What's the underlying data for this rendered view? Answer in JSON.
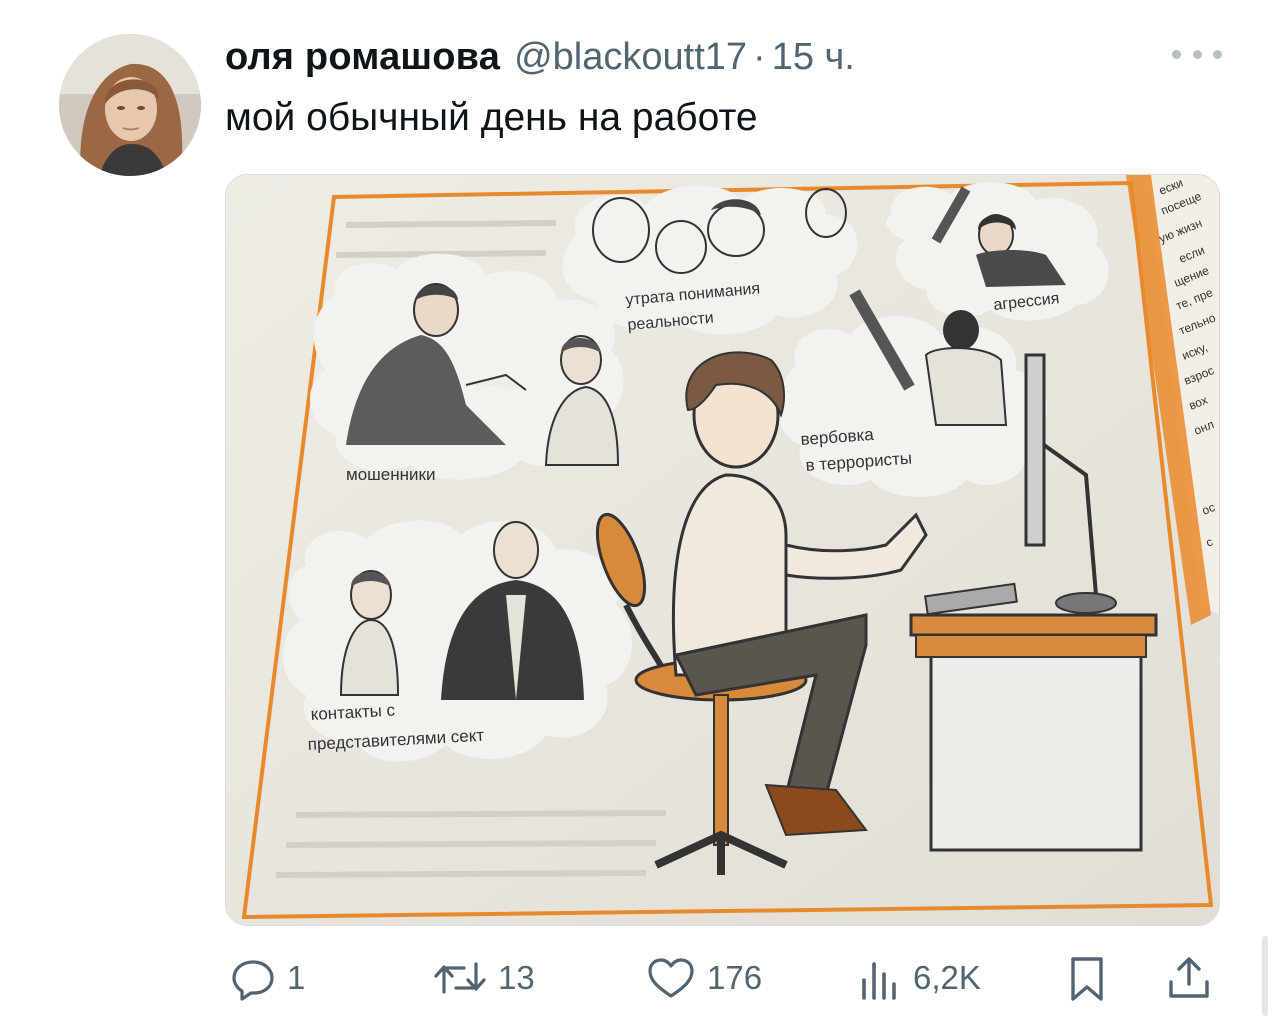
{
  "author": {
    "display_name": "оля ромашова",
    "handle": "@blackoutt17",
    "separator": "·",
    "time": "15 ч."
  },
  "tweet": {
    "text": "мой обычный день на работе"
  },
  "image": {
    "bubbles": {
      "reality": [
        "утрата понимания",
        "реальности"
      ],
      "aggression": "агрессия",
      "fraud": "мошенники",
      "terror": [
        "вербовка",
        "в террористы"
      ],
      "sects": [
        "контакты с",
        "представителями сект"
      ]
    },
    "side_page_text": [
      "ески",
      "посеще",
      "ую жизн",
      "если",
      "щение",
      "те, пре",
      "тельно",
      "иску,",
      "взрос",
      "вох",
      "онл",
      "ос",
      "с"
    ]
  },
  "actions": {
    "reply_count": "1",
    "retweet_count": "13",
    "like_count": "176",
    "views_count": "6,2K"
  },
  "icons": [
    "more-icon",
    "reply-icon",
    "retweet-icon",
    "like-icon",
    "views-icon",
    "bookmark-icon",
    "share-icon"
  ],
  "colors": {
    "text": "#0f1419",
    "secondary": "#536471",
    "page_orange": "#e88a2c"
  }
}
